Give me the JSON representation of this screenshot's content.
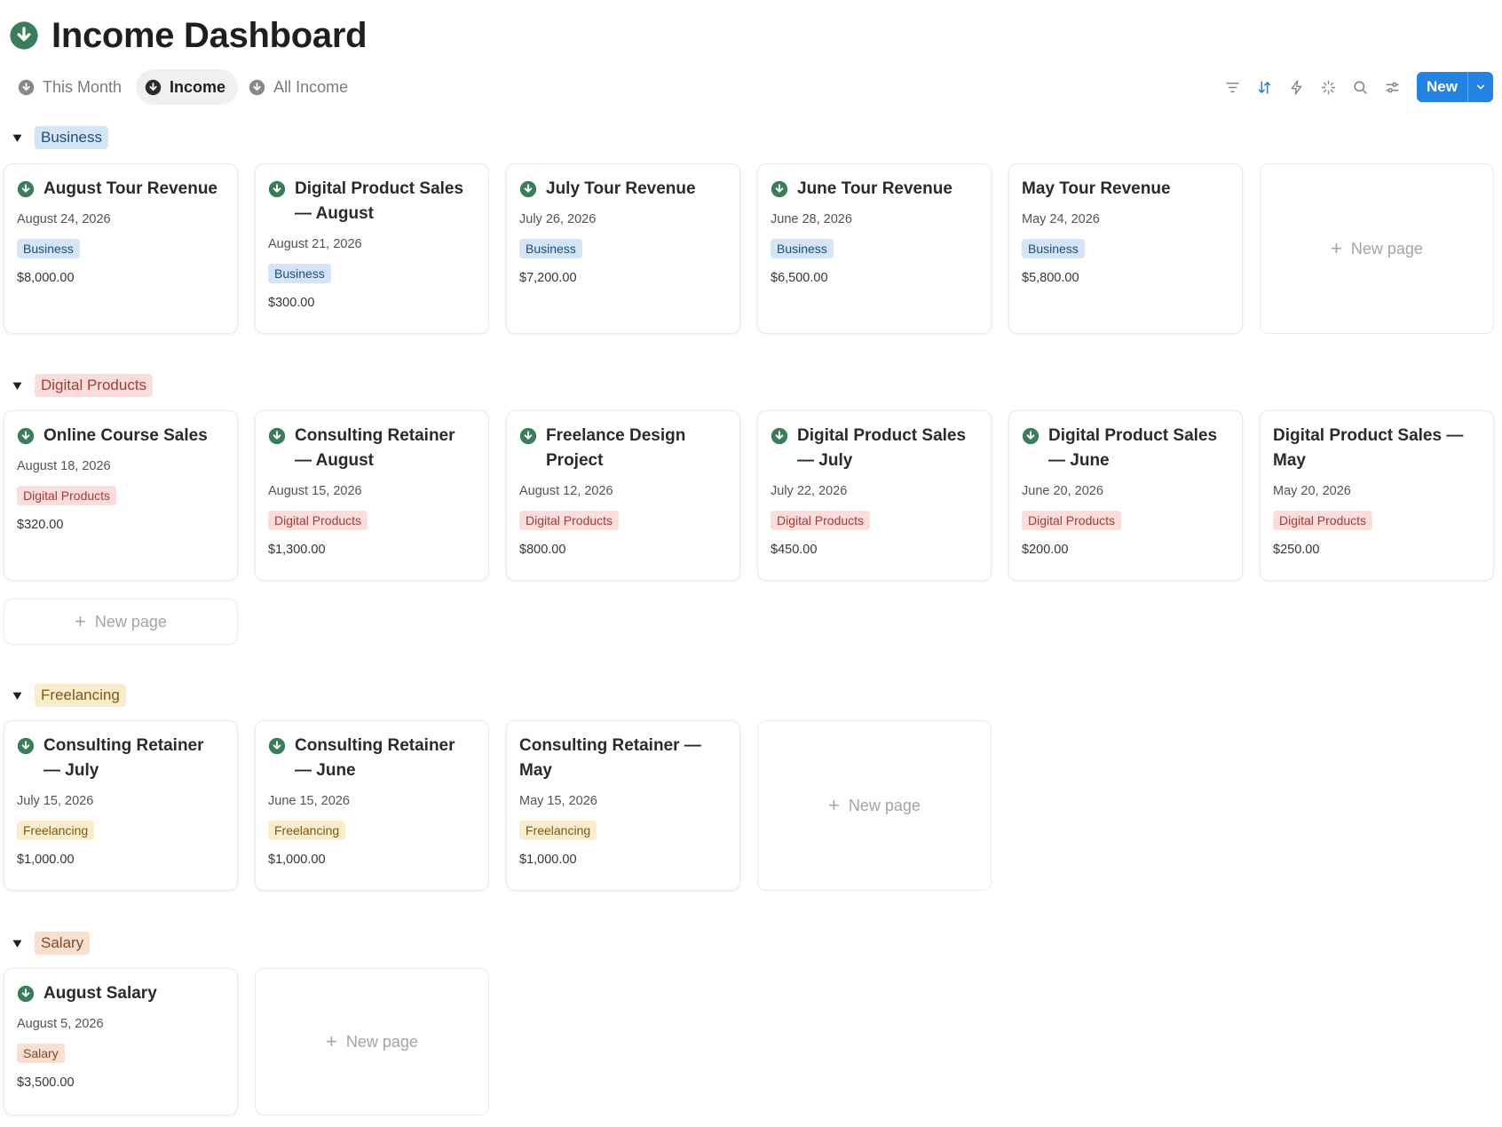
{
  "page": {
    "title": "Income Dashboard"
  },
  "colors": {
    "accent": "#2383e2",
    "icon_green": "#3b7d5a",
    "business_bg": "#d3e5f6",
    "digital_bg": "#fbdedc",
    "freelancing_bg": "#fbeccc",
    "salary_bg": "#f8dfd0"
  },
  "tabs": [
    {
      "label": "This Month",
      "active": false
    },
    {
      "label": "Income",
      "active": true
    },
    {
      "label": "All Income",
      "active": false
    }
  ],
  "toolbar": {
    "icons": [
      "filter-icon",
      "sort-icon",
      "automation-icon",
      "ai-sparkle-icon",
      "search-icon",
      "settings-icon"
    ],
    "new_label": "New"
  },
  "new_page_label": "New page",
  "groups": [
    {
      "name": "Business",
      "cards": [
        {
          "title": "August Tour Revenue",
          "date": "August 24, 2026",
          "tag": "Business",
          "amount": "$8,000.00",
          "icon": true
        },
        {
          "title": "Digital Product Sales — August",
          "date": "August 21, 2026",
          "tag": "Business",
          "amount": "$300.00",
          "icon": true
        },
        {
          "title": "July Tour Revenue",
          "date": "July 26, 2026",
          "tag": "Business",
          "amount": "$7,200.00",
          "icon": true
        },
        {
          "title": "June Tour Revenue",
          "date": "June 28, 2026",
          "tag": "Business",
          "amount": "$6,500.00",
          "icon": true
        },
        {
          "title": "May Tour Revenue",
          "date": "May 24, 2026",
          "tag": "Business",
          "amount": "$5,800.00",
          "icon": false
        }
      ]
    },
    {
      "name": "Digital Products",
      "cards": [
        {
          "title": "Online Course Sales",
          "date": "August 18, 2026",
          "tag": "Digital Products",
          "amount": "$320.00",
          "icon": true
        },
        {
          "title": "Consulting Retainer — August",
          "date": "August 15, 2026",
          "tag": "Digital Products",
          "amount": "$1,300.00",
          "icon": true
        },
        {
          "title": "Freelance Design Project",
          "date": "August 12, 2026",
          "tag": "Digital Products",
          "amount": "$800.00",
          "icon": true
        },
        {
          "title": "Digital Product Sales — July",
          "date": "July 22, 2026",
          "tag": "Digital Products",
          "amount": "$450.00",
          "icon": true
        },
        {
          "title": "Digital Product Sales — June",
          "date": "June 20, 2026",
          "tag": "Digital Products",
          "amount": "$200.00",
          "icon": true
        },
        {
          "title": "Digital Product Sales — May",
          "date": "May 20, 2026",
          "tag": "Digital Products",
          "amount": "$250.00",
          "icon": false
        }
      ]
    },
    {
      "name": "Freelancing",
      "cards": [
        {
          "title": "Consulting Retainer — July",
          "date": "July 15, 2026",
          "tag": "Freelancing",
          "amount": "$1,000.00",
          "icon": true
        },
        {
          "title": "Consulting Retainer — June",
          "date": "June 15, 2026",
          "tag": "Freelancing",
          "amount": "$1,000.00",
          "icon": true
        },
        {
          "title": "Consulting Retainer — May",
          "date": "May 15, 2026",
          "tag": "Freelancing",
          "amount": "$1,000.00",
          "icon": false
        }
      ]
    },
    {
      "name": "Salary",
      "cards": [
        {
          "title": "August Salary",
          "date": "August 5, 2026",
          "tag": "Salary",
          "amount": "$3,500.00",
          "icon": true
        }
      ]
    }
  ]
}
